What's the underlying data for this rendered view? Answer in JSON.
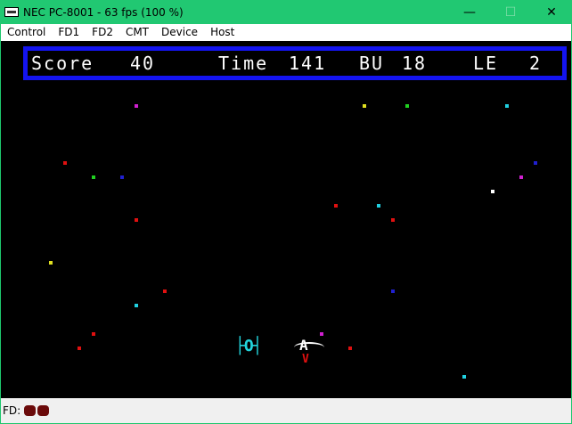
{
  "window": {
    "title": "NEC PC-8001 - 63 fps (100 %)",
    "minimize_glyph": "—",
    "maximize_glyph": "☐",
    "close_glyph": "✕"
  },
  "menu": [
    "Control",
    "FD1",
    "FD2",
    "CMT",
    "Device",
    "Host"
  ],
  "hud": {
    "score_label": "Score",
    "score_value": "40",
    "time_label": "Time",
    "time_value": "141",
    "bu_label": "BU",
    "bu_value": "18",
    "le_label": "LE",
    "le_value": "2",
    "border_color": "#1414f0"
  },
  "game": {
    "enemy_glyph": "├O┤",
    "enemy_color": "#22d4dc",
    "player_glyph": "A",
    "player_color": "#ffffff",
    "player_flame_glyph": "V",
    "player_flame_color": "#e01010",
    "stars": [
      {
        "color": "#d020d0"
      },
      {
        "color": "#e0e020"
      },
      {
        "color": "#20d020"
      },
      {
        "color": "#20d0e0"
      },
      {
        "color": "#e01010"
      },
      {
        "color": "#20d020"
      },
      {
        "color": "#2020d0"
      },
      {
        "color": "#2020d0"
      },
      {
        "color": "#d020d0"
      },
      {
        "color": "#ffffff"
      },
      {
        "color": "#e01010"
      },
      {
        "color": "#20d0e0"
      },
      {
        "color": "#e01010"
      },
      {
        "color": "#e01010"
      },
      {
        "color": "#e0e020"
      },
      {
        "color": "#e01010"
      },
      {
        "color": "#2020d0"
      },
      {
        "color": "#20d0e0"
      },
      {
        "color": "#e01010"
      },
      {
        "color": "#d020d0"
      },
      {
        "color": "#e01010"
      },
      {
        "color": "#e01010"
      },
      {
        "color": "#20d0e0"
      }
    ]
  },
  "status": {
    "fd_label": "FD:",
    "led_color": "#6b0a0a"
  }
}
